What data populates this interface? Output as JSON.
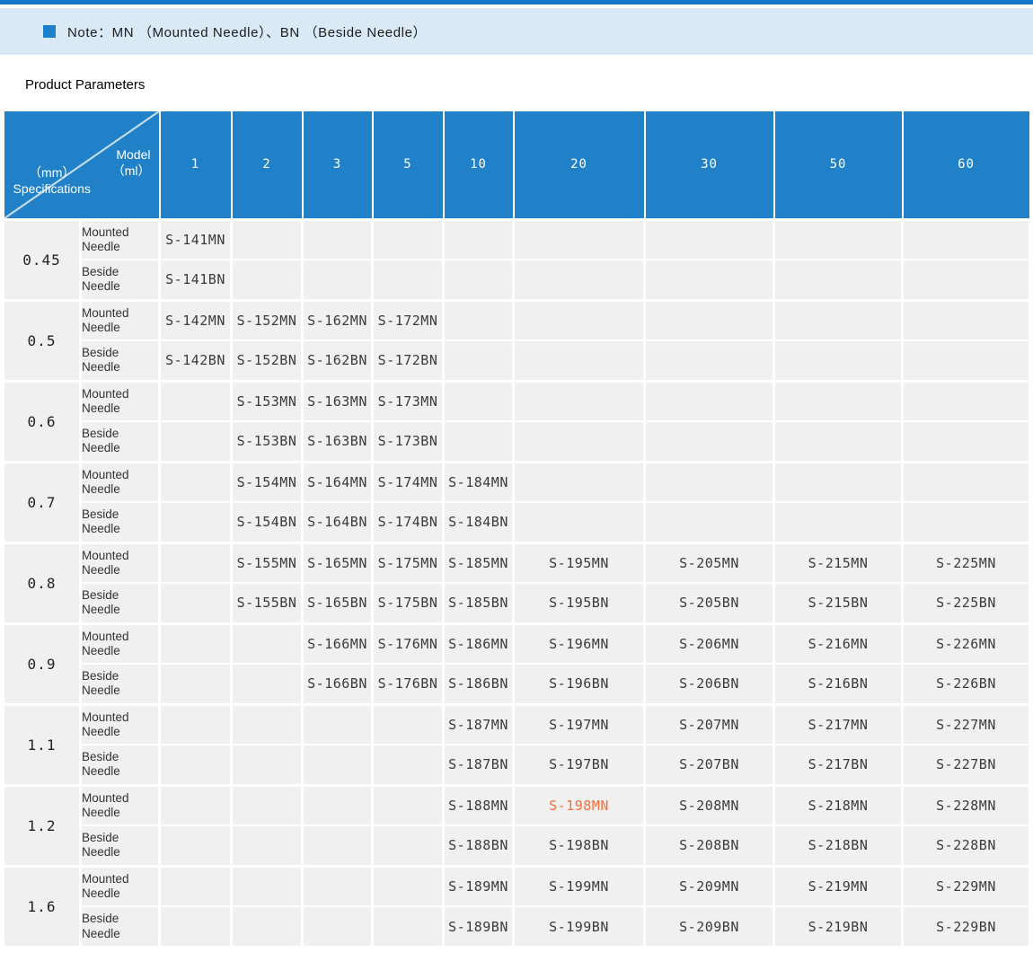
{
  "note": {
    "text": "Note：MN （Mounted Needle）、BN （Beside Needle）"
  },
  "section_title": "Product Parameters",
  "table": {
    "corner": {
      "model_label": "Model",
      "model_unit": "（ml）",
      "spec_unit": "（mm）",
      "spec_label": "Specifications"
    },
    "columns": [
      "1",
      "2",
      "3",
      "5",
      "10",
      "20",
      "30",
      "50",
      "60"
    ],
    "needle_labels": {
      "mounted": "Mounted Needle",
      "beside": "Beside Needle"
    },
    "groups": [
      {
        "spec": "0.45",
        "mounted": [
          "S-141MN",
          "",
          "",
          "",
          "",
          "",
          "",
          "",
          ""
        ],
        "beside": [
          "S-141BN",
          "",
          "",
          "",
          "",
          "",
          "",
          "",
          ""
        ]
      },
      {
        "spec": "0.5",
        "mounted": [
          "S-142MN",
          "S-152MN",
          "S-162MN",
          "S-172MN",
          "",
          "",
          "",
          "",
          ""
        ],
        "beside": [
          "S-142BN",
          "S-152BN",
          "S-162BN",
          "S-172BN",
          "",
          "",
          "",
          "",
          ""
        ]
      },
      {
        "spec": "0.6",
        "mounted": [
          "",
          "S-153MN",
          "S-163MN",
          "S-173MN",
          "",
          "",
          "",
          "",
          ""
        ],
        "beside": [
          "",
          "S-153BN",
          "S-163BN",
          "S-173BN",
          "",
          "",
          "",
          "",
          ""
        ]
      },
      {
        "spec": "0.7",
        "mounted": [
          "",
          "S-154MN",
          "S-164MN",
          "S-174MN",
          "S-184MN",
          "",
          "",
          "",
          ""
        ],
        "beside": [
          "",
          "S-154BN",
          "S-164BN",
          "S-174BN",
          "S-184BN",
          "",
          "",
          "",
          ""
        ]
      },
      {
        "spec": "0.8",
        "mounted": [
          "",
          "S-155MN",
          "S-165MN",
          "S-175MN",
          "S-185MN",
          "S-195MN",
          "S-205MN",
          "S-215MN",
          "S-225MN"
        ],
        "beside": [
          "",
          "S-155BN",
          "S-165BN",
          "S-175BN",
          "S-185BN",
          "S-195BN",
          "S-205BN",
          "S-215BN",
          "S-225BN"
        ]
      },
      {
        "spec": "0.9",
        "mounted": [
          "",
          "",
          "S-166MN",
          "S-176MN",
          "S-186MN",
          "S-196MN",
          "S-206MN",
          "S-216MN",
          "S-226MN"
        ],
        "beside": [
          "",
          "",
          "S-166BN",
          "S-176BN",
          "S-186BN",
          "S-196BN",
          "S-206BN",
          "S-216BN",
          "S-226BN"
        ]
      },
      {
        "spec": "1.1",
        "mounted": [
          "",
          "",
          "",
          "",
          "S-187MN",
          "S-197MN",
          "S-207MN",
          "S-217MN",
          "S-227MN"
        ],
        "beside": [
          "",
          "",
          "",
          "",
          "S-187BN",
          "S-197BN",
          "S-207BN",
          "S-217BN",
          "S-227BN"
        ]
      },
      {
        "spec": "1.2",
        "mounted": [
          "",
          "",
          "",
          "",
          "S-188MN",
          "S-198MN",
          "S-208MN",
          "S-218MN",
          "S-228MN"
        ],
        "beside": [
          "",
          "",
          "",
          "",
          "S-188BN",
          "S-198BN",
          "S-208BN",
          "S-218BN",
          "S-228BN"
        ]
      },
      {
        "spec": "1.6",
        "mounted": [
          "",
          "",
          "",
          "",
          "S-189MN",
          "S-199MN",
          "S-209MN",
          "S-219MN",
          "S-229MN"
        ],
        "beside": [
          "",
          "",
          "",
          "",
          "S-189BN",
          "S-199BN",
          "S-209BN",
          "S-219BN",
          "S-229BN"
        ]
      }
    ],
    "highlight": {
      "group_index": 7,
      "row": "mounted",
      "col_index": 5,
      "value": "S-198MN",
      "color": "#F4703C"
    },
    "colors": {
      "top_line": "#1677C8",
      "note_band_bg": "#D9E9F6",
      "note_square": "#1C80CC",
      "header_bg": "#2080C8",
      "cell_bg": "#F0F0F0",
      "grid": "#FFFFFF",
      "text": "#3B3B3B",
      "highlight_text": "#F4703C"
    }
  }
}
